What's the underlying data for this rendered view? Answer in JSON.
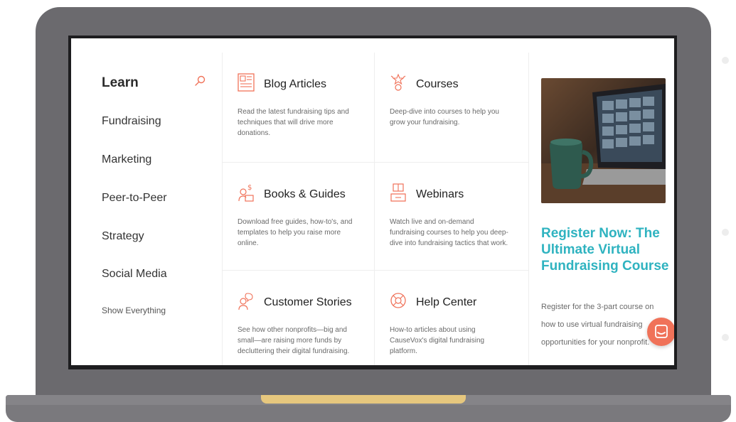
{
  "nav": {
    "heading": "Learn",
    "items": [
      {
        "label": "Fundraising"
      },
      {
        "label": "Marketing"
      },
      {
        "label": "Peer-to-Peer"
      },
      {
        "label": "Strategy"
      },
      {
        "label": "Social Media"
      }
    ],
    "show_all": "Show Everything",
    "search_icon": "search-icon"
  },
  "grid": {
    "cards": [
      {
        "title": "Blog Articles",
        "desc": "Read the latest fundraising tips and techniques that will drive more donations.",
        "icon": "document-icon"
      },
      {
        "title": "Courses",
        "desc": "Deep-dive into courses to help you grow your fundraising.",
        "icon": "courses-icon"
      },
      {
        "title": "Books & Guides",
        "desc": "Download free guides, how-to's, and templates to help you raise more online.",
        "icon": "book-money-icon"
      },
      {
        "title": "Webinars",
        "desc": "Watch live and on-demand fundraising courses to help you deep-dive into fundraising tactics that work.",
        "icon": "webinar-icon"
      },
      {
        "title": "Customer Stories",
        "desc": "See how other nonprofits—big and small—are raising more funds by decluttering their digital fundraising.",
        "icon": "customer-chat-icon"
      },
      {
        "title": "Help Center",
        "desc": "How-to articles about using CauseVox's digital fundraising platform.",
        "icon": "lifebuoy-icon"
      }
    ]
  },
  "promo": {
    "headline": "Register Now: The Ultimate Virtual Fundraising Course",
    "body": "Register for the 3-part course on how to use virtual fundraising opportunities for your nonprofit."
  },
  "colors": {
    "accent": "#f07259",
    "headline": "#2fb3c0",
    "laptop": "#6b6a6e",
    "hinge": "#e6c77e"
  }
}
